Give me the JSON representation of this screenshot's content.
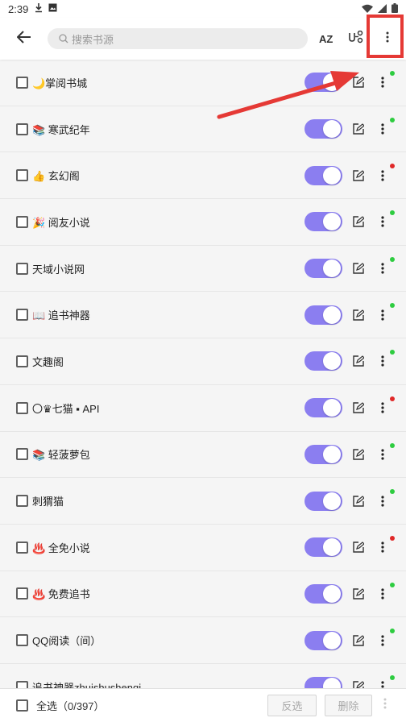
{
  "statusbar": {
    "time": "2:39",
    "icons": [
      "download-icon",
      "image-notification-icon",
      "wifi-icon",
      "signal-icon",
      "battery-icon"
    ]
  },
  "toolbar": {
    "search_placeholder": "搜索书源",
    "sort_label": "AZ",
    "icons": [
      "back-arrow-icon",
      "search-icon",
      "sort-az-icon",
      "group-icon",
      "more-vertical-icon"
    ]
  },
  "sources": [
    {
      "name": "🌙掌阅书城",
      "enabled": true,
      "status": "green"
    },
    {
      "name": "📚 寒武纪年",
      "enabled": true,
      "status": "green"
    },
    {
      "name": "👍 玄幻阁",
      "enabled": true,
      "status": "red"
    },
    {
      "name": "🎉 阅友小说",
      "enabled": true,
      "status": "green"
    },
    {
      "name": "天域小说网",
      "enabled": true,
      "status": "green"
    },
    {
      "name": "📖 追书神器",
      "enabled": true,
      "status": "green"
    },
    {
      "name": "文趣阁",
      "enabled": true,
      "status": "green"
    },
    {
      "name": "〇♛七猫 ▪ API",
      "enabled": true,
      "status": "red"
    },
    {
      "name": "📚 轻菠萝包",
      "enabled": true,
      "status": "green"
    },
    {
      "name": "刺猬猫",
      "enabled": true,
      "status": "green"
    },
    {
      "name": "♨️ 全免小说",
      "enabled": true,
      "status": "red"
    },
    {
      "name": "♨️ 免费追书",
      "enabled": true,
      "status": "green"
    },
    {
      "name": "QQ阅读（间）",
      "enabled": true,
      "status": "green"
    },
    {
      "name": "追书神器zhuishushenqi",
      "enabled": true,
      "status": "green"
    }
  ],
  "bottombar": {
    "select_all": "全选（0/397）",
    "invert_label": "反选",
    "delete_label": "删除"
  },
  "colors": {
    "accent": "#8b7ef0",
    "status_ok": "#2ecc40",
    "status_error": "#e02828",
    "annotation": "#e53935"
  }
}
